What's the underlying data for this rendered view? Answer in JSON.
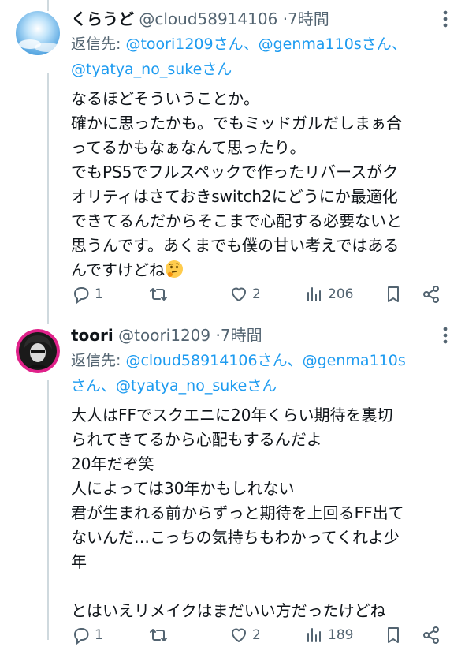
{
  "tweet1": {
    "name": "くらうど",
    "handle": "@cloud58914106",
    "dot": "·",
    "time": "7時間",
    "reply_prefix": "返信先: ",
    "mentions": [
      {
        "text": "@toori1209さん、"
      },
      {
        "text": "@genma110sさん、"
      },
      {
        "text": "@tyatya_no_sukeさん"
      }
    ],
    "body_lines": [
      "なるほどそういうことか。",
      "確かに思ったかも。でもミッドガルだしまぁ合",
      "ってるかもなぁなんて思ったり。",
      "でもPS5でフルスペックで作ったリバースがク",
      "オリティはさておきswitch2にどうにか最適化",
      "できてるんだからそこまで心配する必要ないと",
      "思うんです。あくまでも僕の甘い考えではある",
      "んですけどね"
    ],
    "emoji": "thinking-face",
    "replies": "1",
    "reposts": "",
    "likes": "2",
    "views": "206"
  },
  "tweet2": {
    "name": "toori",
    "handle": "@toori1209",
    "dot": "·",
    "time": "7時間",
    "reply_prefix": "返信先: ",
    "mentions": [
      {
        "text": "@cloud58914106さん、"
      },
      {
        "text": "@genma110s"
      },
      {
        "text": "さん、@tyatya_no_sukeさん"
      }
    ],
    "body_lines": [
      "大人はFFでスクエニに20年くらい期待を裏切",
      "られてきてるから心配もするんだよ",
      "20年だぞ笑",
      "人によっては30年かもしれない",
      "君が生まれる前からずっと期待を上回るFF出て",
      "ないんだ…こっちの気持ちもわかってくれよ少",
      "年",
      "",
      "とはいえリメイクはまだいい方だったけどね"
    ],
    "replies": "1",
    "reposts": "",
    "likes": "2",
    "views": "189"
  },
  "colors": {
    "text": "#0f1419",
    "secondary": "#536471",
    "link": "#1d9bf0",
    "thread_line": "#cfd9de",
    "avatar2_ring": "#e0218a"
  }
}
